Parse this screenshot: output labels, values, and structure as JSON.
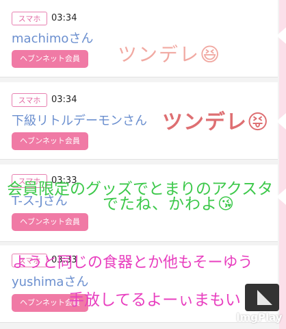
{
  "cards": [
    {
      "badge": "スマホ",
      "time": "03:34",
      "name": "machimoさん",
      "member": "ヘブンネット会員"
    },
    {
      "badge": "スマホ",
      "time": "03:34",
      "name": "下級リトルデーモンさん",
      "member": "ヘブンネット会員"
    },
    {
      "badge": "スマホ",
      "time": "03:33",
      "name": "T-ス-Jさん",
      "member": "ヘブンネット会員"
    },
    {
      "badge": "スマホ",
      "time": "03:33",
      "name": "yushimaさん",
      "member": "ヘブンネット会員"
    }
  ],
  "overlays": {
    "line1": "ツンデレ😆",
    "line2": "ツンデレ😝",
    "line3": "会員限定のグッズでとまりのアクスタ",
    "line4": "でたね、かわよ😘",
    "line5": "ようと同じの食器とか他もそーゆう",
    "line6": "手放してるよーぃまもい"
  },
  "watermark": "ImgPlay",
  "colors": {
    "badge_border": "#e77fb0",
    "member_button": "#f07aa5",
    "name_text": "#6b8fcf",
    "overlay_green": "#3cc84a",
    "overlay_magenta": "#e83fbf",
    "overlay_pink": "#f1a9a2",
    "overlay_red": "#de6f72",
    "scrollbar": "#fbe0ea"
  }
}
